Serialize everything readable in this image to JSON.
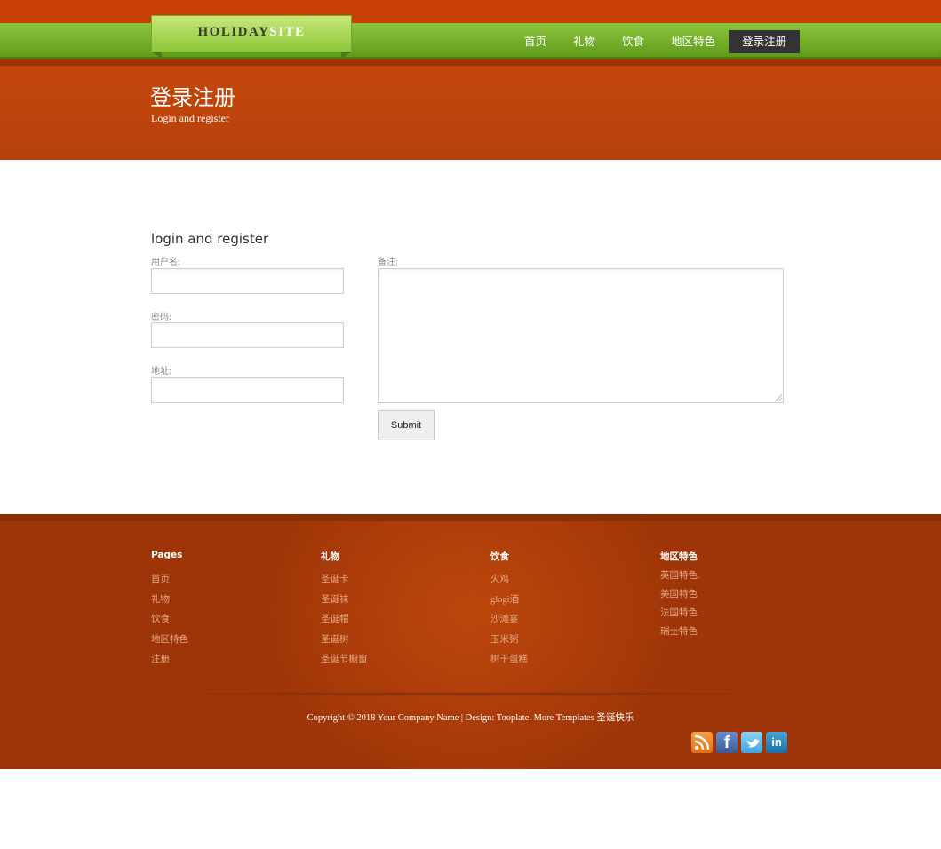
{
  "logo": {
    "part1": "HOLIDAY",
    "part2": "SITE"
  },
  "nav": {
    "items": [
      "首页",
      "礼物",
      "饮食",
      "地区特色",
      "登录注册"
    ],
    "active_index": 4
  },
  "hero": {
    "title": "登录注册",
    "subtitle": "Login and register"
  },
  "form": {
    "title": "login and register",
    "username_label": "用户名:",
    "password_label": "密码:",
    "address_label": "地址:",
    "note_label": "备注:",
    "submit_label": "Submit",
    "username_value": "",
    "password_value": "",
    "address_value": "",
    "note_value": ""
  },
  "footer": {
    "columns": [
      {
        "title": "Pages",
        "links": [
          "首页",
          "礼物",
          "饮食",
          "地区特色",
          "注册"
        ]
      },
      {
        "title": "礼物",
        "links": [
          "圣诞卡",
          "圣诞袜",
          "圣诞帽",
          "圣诞树",
          "圣诞节橱窗"
        ]
      },
      {
        "title": "饮食",
        "links": [
          "火鸡",
          "glogi酒",
          "沙滩宴",
          "玉米粥",
          "树干蛋糕"
        ]
      },
      {
        "title": "地区特色",
        "links": [
          "英国特色.",
          "美国特色",
          "法国特色.",
          "瑞士特色"
        ]
      }
    ],
    "copyright": "Copyright © 2018 Your Company Name | Design: Tooplate. More Templates 圣诞快乐",
    "social_icons": [
      "rss-icon",
      "facebook-icon",
      "twitter-icon",
      "linkedin-icon"
    ]
  },
  "colors": {
    "header_orange": "#c93f08",
    "nav_green": "#7ab42a",
    "footer_brown": "#a3380a",
    "active_nav": "#333333"
  }
}
